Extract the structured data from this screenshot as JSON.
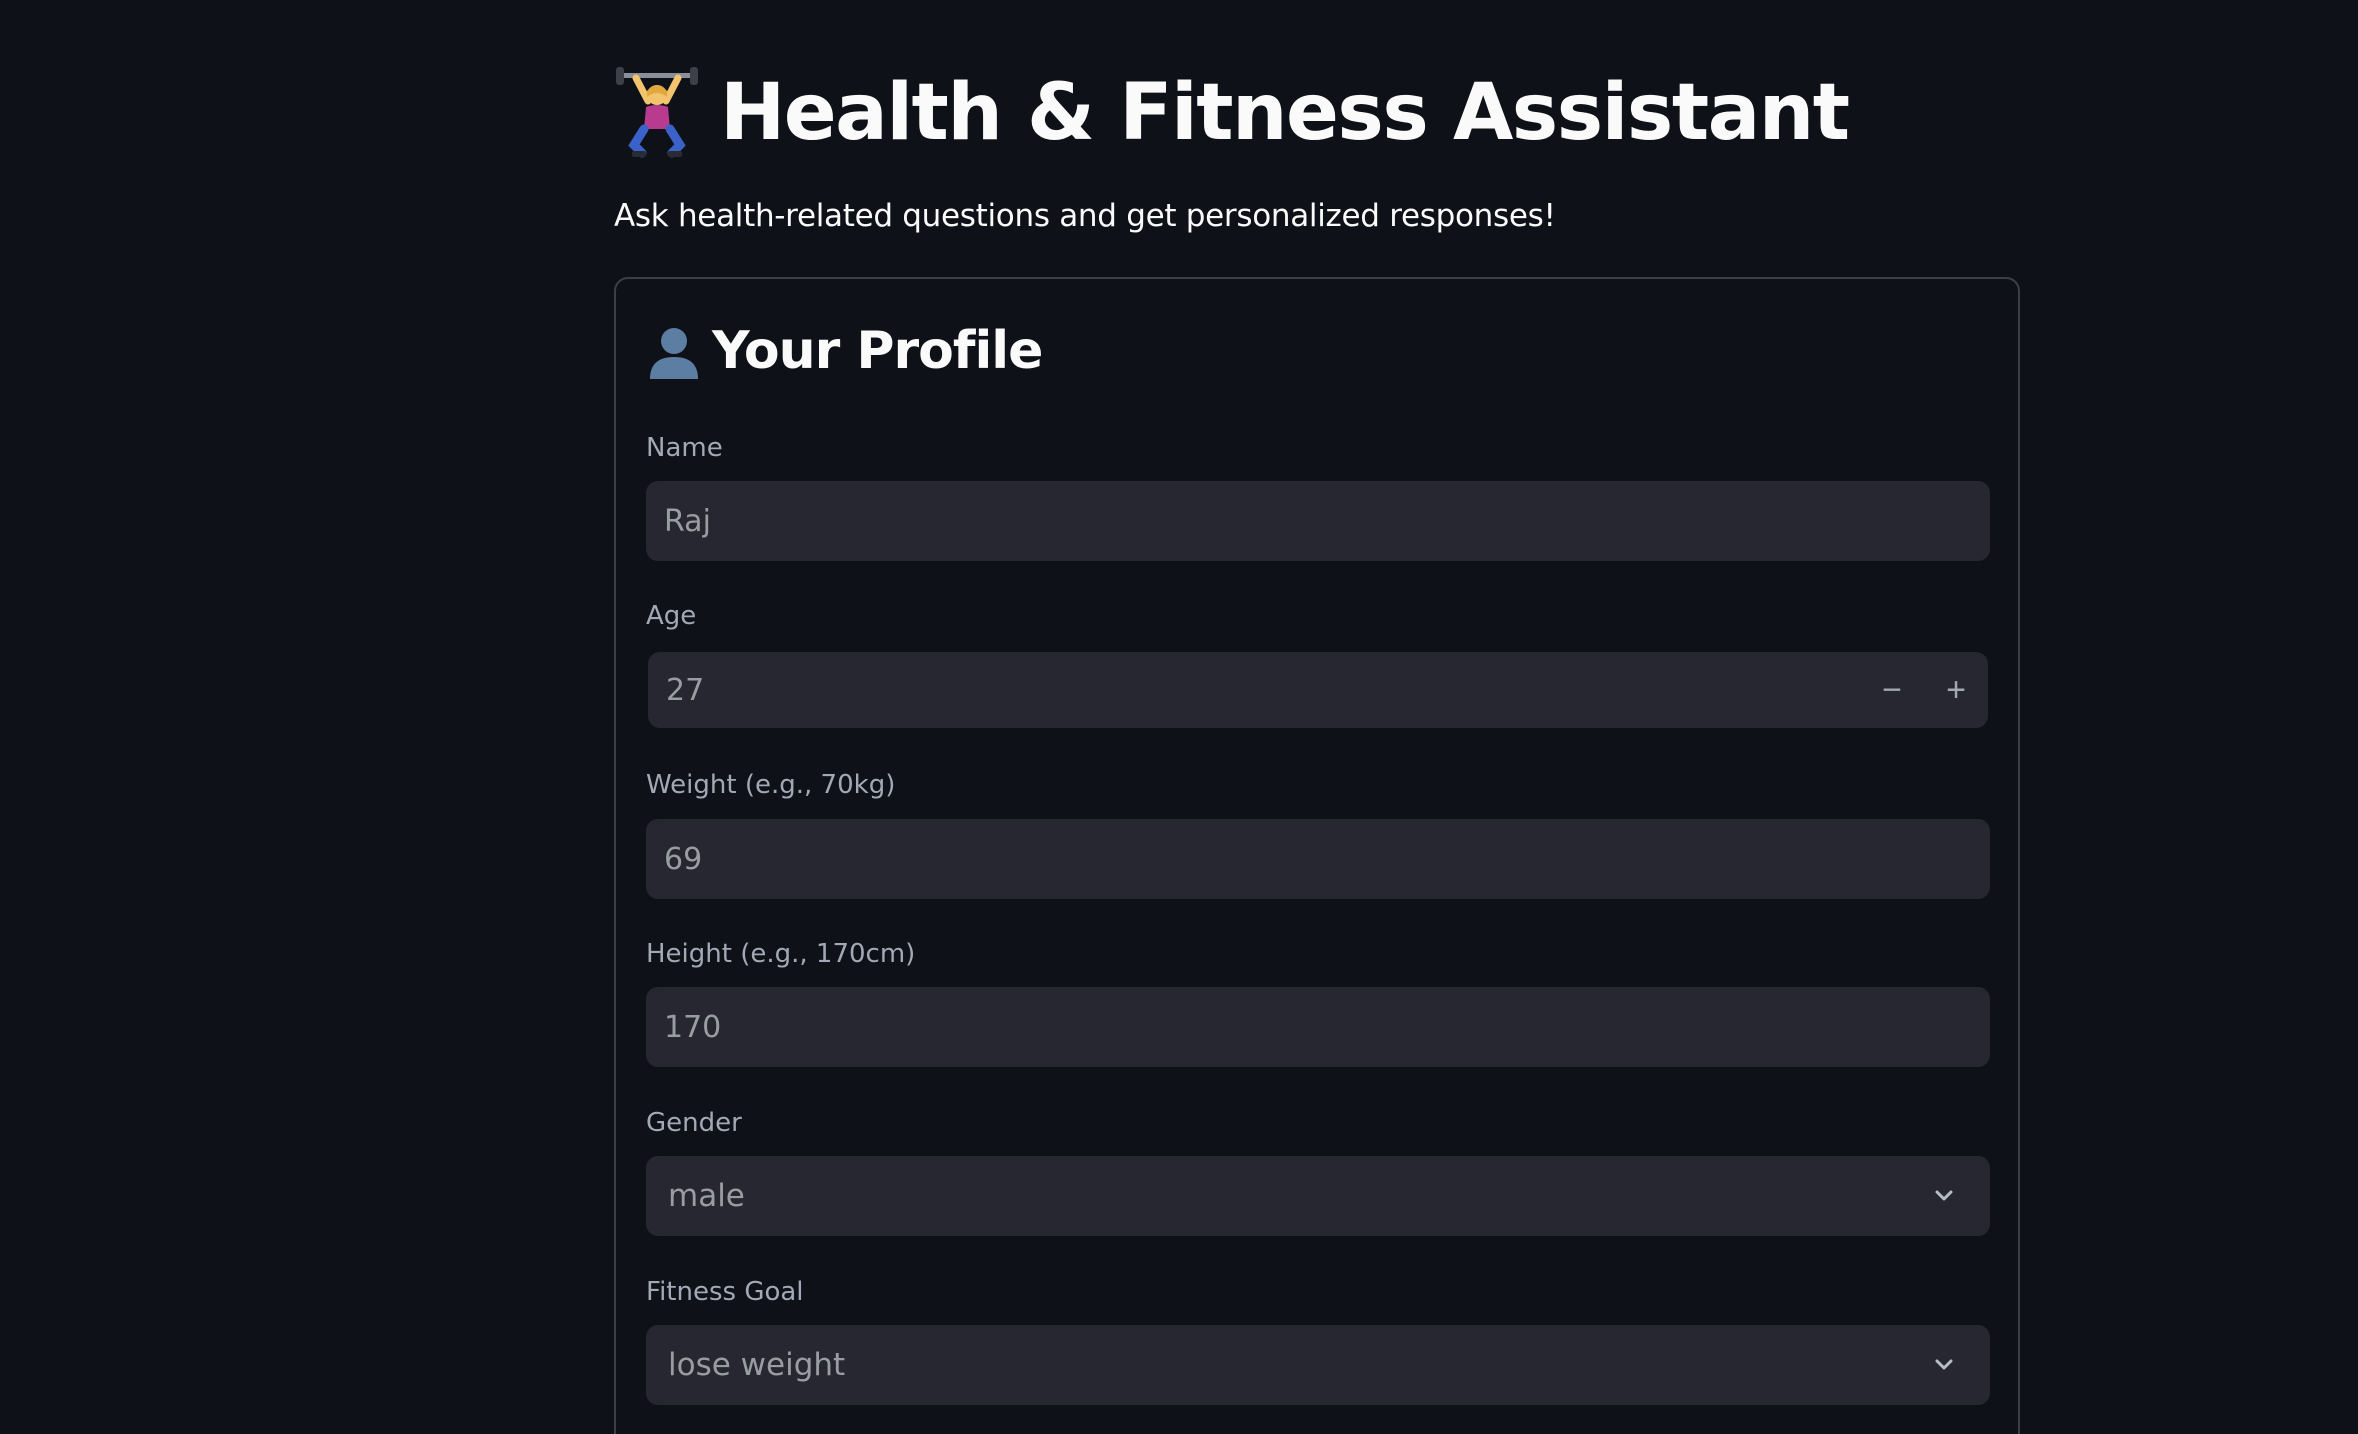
{
  "header": {
    "title": "Health & Fitness Assistant",
    "title_icon": "weightlifter-icon",
    "subtitle": "Ask health-related questions and get personalized responses!"
  },
  "profile": {
    "heading": "Your Profile",
    "heading_icon": "bust-silhouette-icon",
    "name": {
      "label": "Name",
      "value": "Raj"
    },
    "age": {
      "label": "Age",
      "value": "27",
      "decrement": "−",
      "increment": "+"
    },
    "weight": {
      "label": "Weight (e.g., 70kg)",
      "value": "69"
    },
    "height": {
      "label": "Height (e.g., 170cm)",
      "value": "170"
    },
    "gender": {
      "label": "Gender",
      "value": "male"
    },
    "fitness_goal": {
      "label": "Fitness Goal",
      "value": "lose weight"
    }
  },
  "colors": {
    "background": "#0e1117",
    "input_background": "#262730",
    "text": "#fafafa",
    "muted_text": "#a3a8b4"
  }
}
